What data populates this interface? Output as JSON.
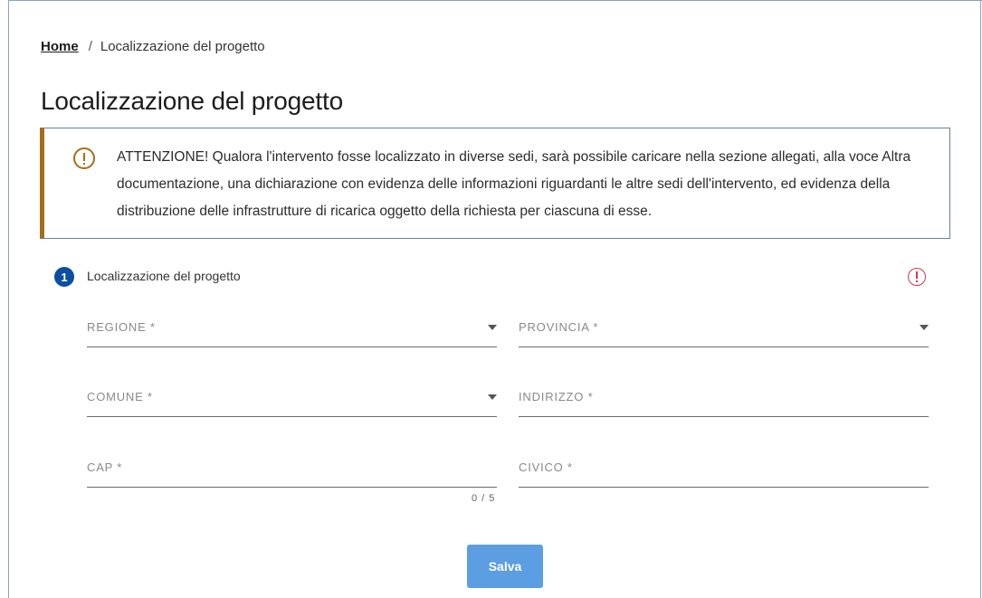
{
  "breadcrumb": {
    "home_label": "Home",
    "separator": "/",
    "current_label": "Localizzazione del progetto"
  },
  "page": {
    "title": "Localizzazione del progetto"
  },
  "alert": {
    "icon": "warning-circle-icon",
    "text": "ATTENZIONE! Qualora l'intervento fosse localizzato in diverse sedi, sarà possibile caricare nella sezione allegati, alla voce Altra documentazione, una dichiarazione con evidenza delle informazioni riguardanti le altre sedi dell'intervento, ed evidenza della distribuzione delle infrastrutture di ricarica oggetto della richiesta per ciascuna di esse."
  },
  "step": {
    "number": "1",
    "label": "Localizzazione del progetto",
    "status_icon": "error-circle-icon"
  },
  "form": {
    "regione_label": "REGIONE *",
    "provincia_label": "PROVINCIA *",
    "comune_label": "COMUNE *",
    "indirizzo_label": "INDIRIZZO *",
    "cap_label": "CAP *",
    "cap_counter": "0 / 5",
    "civico_label": "CIVICO *"
  },
  "actions": {
    "save_label": "Salva"
  },
  "colors": {
    "alert_accent": "#a66d17",
    "step_badge": "#0b4ea2",
    "error": "#d9364f",
    "save_button": "#5b9ee1"
  }
}
